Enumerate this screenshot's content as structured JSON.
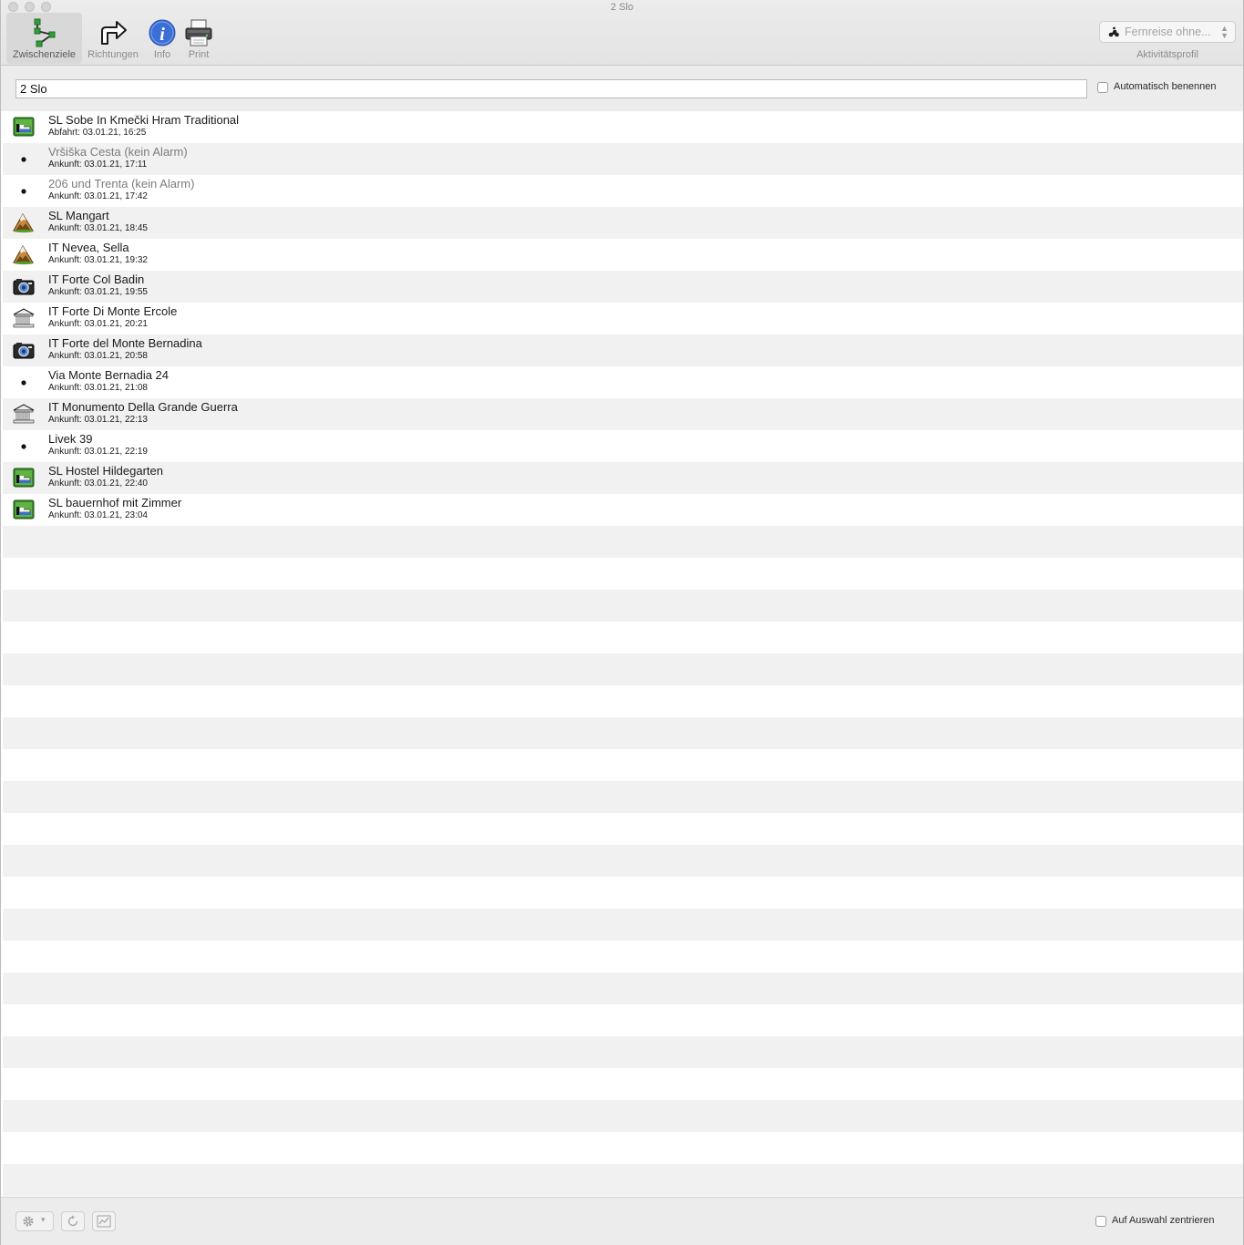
{
  "window": {
    "title": "2 Slo"
  },
  "toolbar": {
    "buttons": [
      {
        "label": "Zwischenziele",
        "icon": "route-waypoints-icon",
        "active": true
      },
      {
        "label": "Richtungen",
        "icon": "turn-arrow-icon",
        "active": false
      },
      {
        "label": "Info",
        "icon": "info-icon",
        "active": false
      },
      {
        "label": "Print",
        "icon": "printer-icon",
        "active": false
      }
    ],
    "profile": {
      "value": "Fernreise ohne...",
      "label": "Aktivitätsprofil",
      "icon": "motorcycle-icon"
    }
  },
  "route": {
    "name": "2 Slo",
    "auto_name_label": "Automatisch benennen",
    "auto_name_checked": false
  },
  "waypoints": [
    {
      "title": "SL Sobe In Kmečki Hram Traditional",
      "subtitle": "Abfahrt: 03.01.21, 16:25",
      "icon": "lodging-icon",
      "muted": false
    },
    {
      "title": "Vršiška Cesta (kein Alarm)",
      "subtitle": "Ankunft: 03.01.21, 17:11",
      "icon": "shaping-point-icon",
      "muted": true
    },
    {
      "title": "206 und Trenta (kein Alarm)",
      "subtitle": "Ankunft: 03.01.21, 17:42",
      "icon": "shaping-point-icon",
      "muted": true
    },
    {
      "title": "SL Mangart",
      "subtitle": "Ankunft: 03.01.21, 18:45",
      "icon": "mountain-icon",
      "muted": false
    },
    {
      "title": "IT Nevea, Sella",
      "subtitle": "Ankunft: 03.01.21, 19:32",
      "icon": "mountain-icon",
      "muted": false
    },
    {
      "title": "IT Forte Col Badin",
      "subtitle": "Ankunft: 03.01.21, 19:55",
      "icon": "camera-icon",
      "muted": false
    },
    {
      "title": "IT Forte Di Monte Ercole",
      "subtitle": "Ankunft: 03.01.21, 20:21",
      "icon": "museum-icon",
      "muted": false
    },
    {
      "title": "IT Forte del Monte Bernadina",
      "subtitle": "Ankunft: 03.01.21, 20:58",
      "icon": "camera-icon",
      "muted": false
    },
    {
      "title": "Via Monte Bernadia 24",
      "subtitle": "Ankunft: 03.01.21, 21:08",
      "icon": "shaping-point-icon",
      "muted": false
    },
    {
      "title": "IT Monumento Della Grande Guerra",
      "subtitle": "Ankunft: 03.01.21, 22:13",
      "icon": "museum-icon",
      "muted": false
    },
    {
      "title": "Livek 39",
      "subtitle": "Ankunft: 03.01.21, 22:19",
      "icon": "shaping-point-icon",
      "muted": false
    },
    {
      "title": "SL Hostel Hildegarten",
      "subtitle": "Ankunft: 03.01.21, 22:40",
      "icon": "lodging-icon",
      "muted": false
    },
    {
      "title": "SL bauernhof mit Zimmer",
      "subtitle": "Ankunft: 03.01.21, 23:04",
      "icon": "lodging-icon",
      "muted": false
    }
  ],
  "bottombar": {
    "buttons": [
      {
        "icon": "gear-icon"
      },
      {
        "icon": "refresh-icon"
      },
      {
        "icon": "elevation-chart-icon"
      }
    ],
    "center_label": "Auf Auswahl zentrieren",
    "center_checked": false
  },
  "colors": {
    "info_blue": "#3b6fd6",
    "route_green": "#2f9e3a",
    "lodging_green": "#3a8a2a",
    "mountain_brown": "#8a5a2a"
  }
}
